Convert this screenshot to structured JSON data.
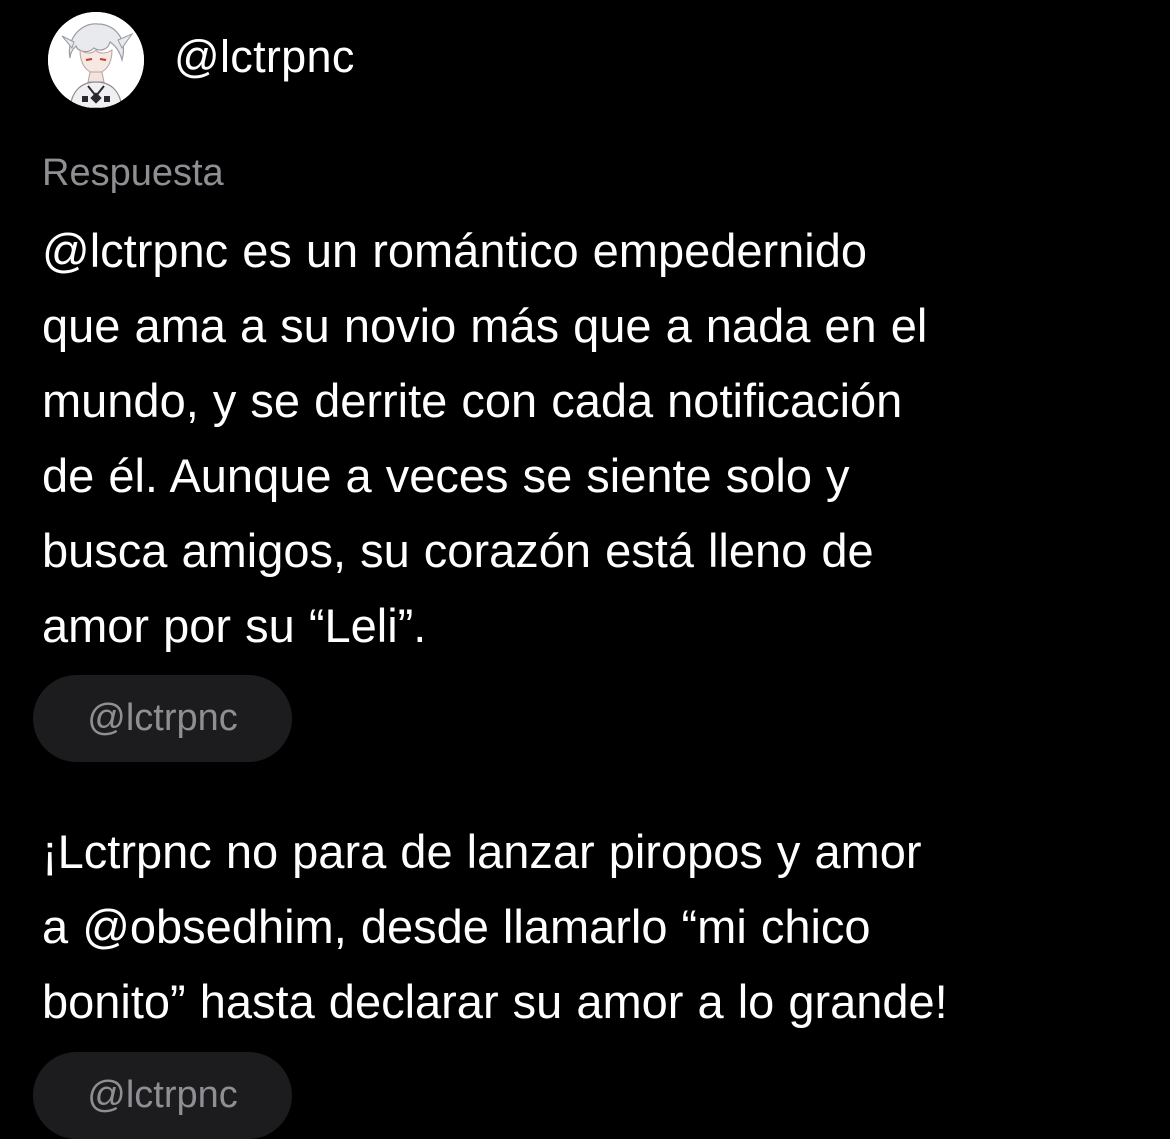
{
  "header": {
    "username": "@lctrpnc"
  },
  "reply": {
    "label": "Respuesta",
    "lines": [
      "@lctrpnc es un romántico empedernido",
      "que ama a su novio más que a nada en el",
      "mundo, y se derrite con cada notificación",
      "de él. Aunque a veces se siente solo y",
      "busca amigos, su corazón está lleno de",
      "amor por su “Leli”."
    ],
    "chip": "@lctrpnc"
  },
  "second": {
    "lines": [
      "¡Lctrpnc no para de lanzar piropos y amor",
      "a @obsedhim, desde llamarlo “mi chico",
      "bonito” hasta declarar su amor a lo grande!"
    ],
    "chip": "@lctrpnc"
  },
  "colors": {
    "background": "#000000",
    "text": "#ffffff",
    "muted": "#8e8e93",
    "chip_bg": "#1c1c1e"
  }
}
